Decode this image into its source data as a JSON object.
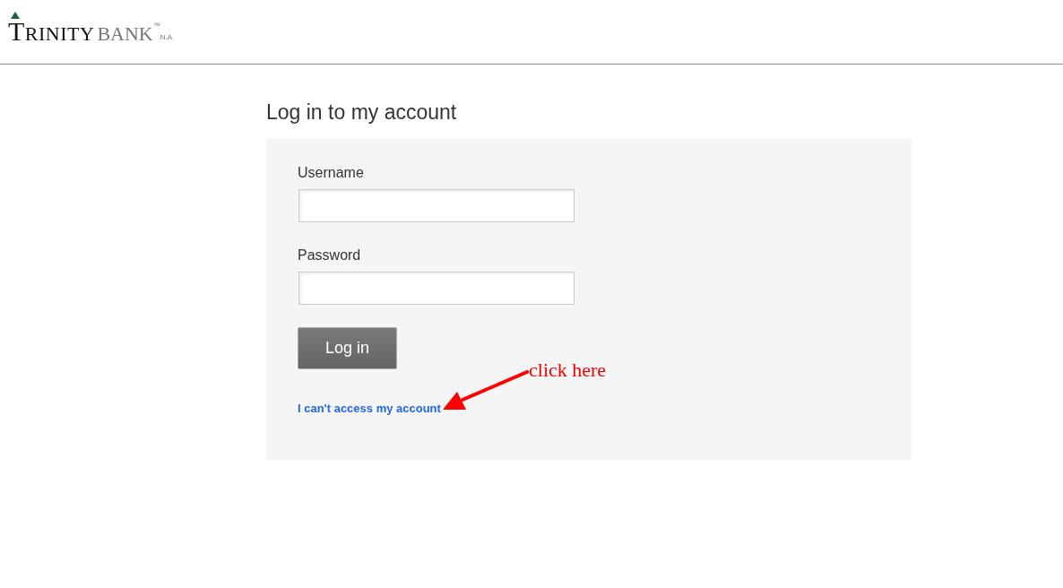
{
  "header": {
    "logo": {
      "name": "TRINITY",
      "bank": "BANK",
      "trademark": "™",
      "suffix": "N.A."
    }
  },
  "title": "Log in to my account",
  "form": {
    "fields": [
      {
        "label": "Username"
      },
      {
        "label": "Password"
      }
    ],
    "submit": "Log in",
    "help_link": "I can't access my account"
  },
  "annotation": {
    "text": "click here"
  }
}
